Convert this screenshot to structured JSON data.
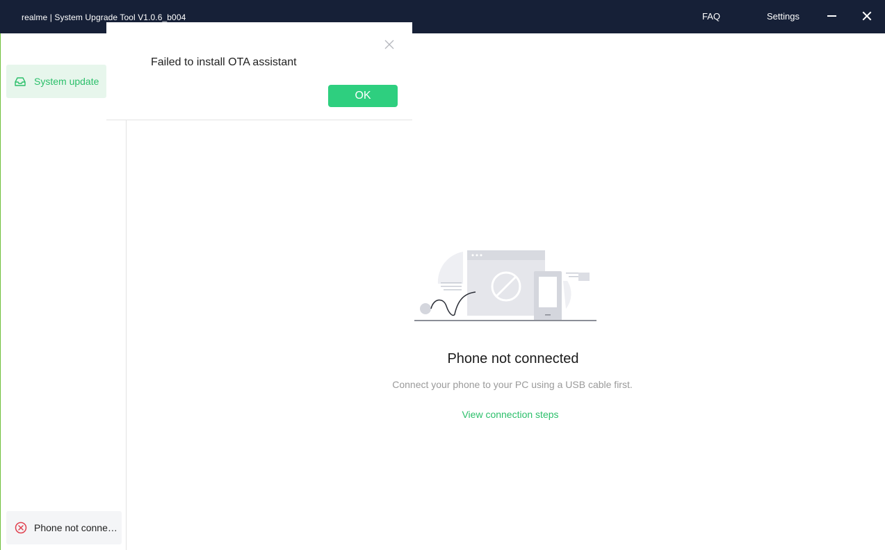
{
  "window": {
    "title": "realme | System Upgrade Tool  V1.0.6_b004",
    "faq_label": "FAQ",
    "settings_label": "Settings"
  },
  "sidebar": {
    "items": [
      {
        "label": "System update",
        "icon": "inbox-icon"
      }
    ],
    "status": {
      "text": "Phone not connected",
      "icon": "error-circle-icon"
    }
  },
  "main": {
    "title": "Phone not connected",
    "subtitle": "Connect your phone to your PC using a USB cable first.",
    "link": "View connection steps"
  },
  "dialog": {
    "message": "Failed to install OTA assistant",
    "ok_label": "OK"
  },
  "colors": {
    "titlebar": "#162037",
    "accent": "#2bbf6a",
    "button": "#2ecf7f",
    "error": "#e0414f"
  }
}
